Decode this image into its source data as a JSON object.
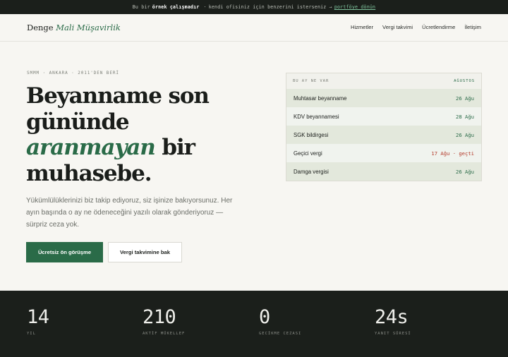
{
  "topbar": {
    "prefix": "Bu bir",
    "bold": "örnek çalışmadır",
    "sep": "·",
    "middle": "kendi ofisiniz için benzerini isterseniz →",
    "link": "portföye dönün"
  },
  "nav": {
    "brand_main": "Denge",
    "brand_accent": "Mali Müşavirlik",
    "items": [
      "Hizmetler",
      "Vergi takvimi",
      "Ücretlendirme",
      "İletişim"
    ]
  },
  "hero": {
    "eyebrow": "SMMM · ANKARA · 2011'DEN BERİ",
    "title_line1": "Beyanname son",
    "title_line2": "gününde",
    "title_em": "aranmayan",
    "title_after_em": " bir",
    "title_line4": "muhasebe.",
    "lead": "Yükümlülüklerinizi biz takip ediyoruz, siz işinize bakıyorsunuz. Her ayın başında o ay ne ödeneceğini yazılı olarak gönderiyoruz — sürpriz ceza yok.",
    "cta_primary": "Ücretsiz ön görüşme",
    "cta_secondary": "Vergi takvimine bak"
  },
  "calendar": {
    "header": "BU AY NE VAR",
    "month": "AĞUSTOS",
    "rows": [
      {
        "name": "Muhtasar beyanname",
        "date": "26 Ağu"
      },
      {
        "name": "KDV beyannamesi",
        "date": "28 Ağu"
      },
      {
        "name": "SGK bildirgesi",
        "date": "26 Ağu"
      },
      {
        "name": "Geçici vergi",
        "date": "17 Ağu · geçti"
      },
      {
        "name": "Damga vergisi",
        "date": "26 Ağu"
      }
    ]
  },
  "stats": [
    {
      "value": "14",
      "label": "YIL"
    },
    {
      "value": "210",
      "label": "AKTİF MÜKELLEF"
    },
    {
      "value": "0",
      "label": "GECİKME CEZASI"
    },
    {
      "value": "24s",
      "label": "YANIT SÜRESİ"
    }
  ]
}
